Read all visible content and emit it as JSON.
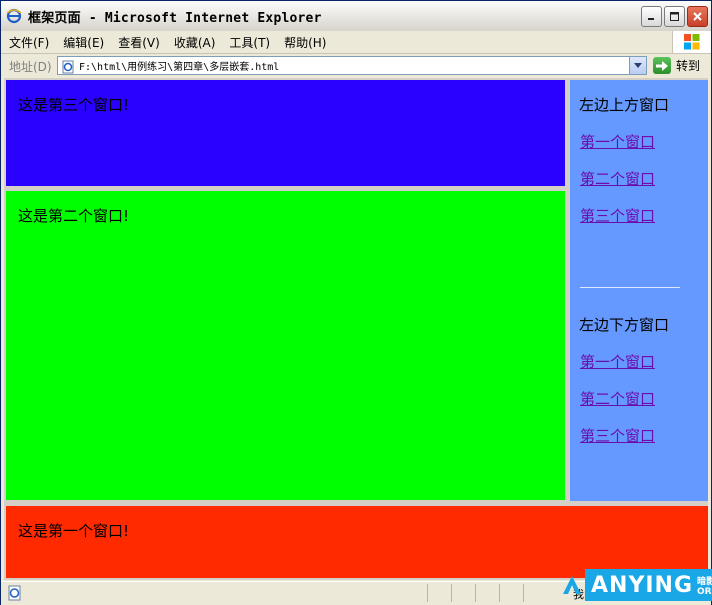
{
  "window": {
    "title": "框架页面 - Microsoft Internet Explorer"
  },
  "menu": {
    "items": [
      {
        "label": "文件(F)"
      },
      {
        "label": "编辑(E)"
      },
      {
        "label": "查看(V)"
      },
      {
        "label": "收藏(A)"
      },
      {
        "label": "工具(T)"
      },
      {
        "label": "帮助(H)"
      }
    ]
  },
  "address_bar": {
    "label": "地址(D)",
    "value": "F:\\html\\用例练习\\第四章\\多层嵌套.html",
    "go_label": "转到"
  },
  "frames": {
    "third": {
      "text": "这是第三个窗口!",
      "color": "#2a00ff"
    },
    "second": {
      "text": "这是第二个窗口!",
      "color": "#00ff00"
    },
    "first": {
      "text": "这是第一个窗口!",
      "color": "#ff2a00"
    },
    "nav": {
      "color": "#6699ff",
      "upper_heading": "左边上方窗口",
      "upper_links": [
        "第一个窗口",
        "第二个窗口",
        "第三个窗口"
      ],
      "lower_heading": "左边下方窗口",
      "lower_links": [
        "第一个窗口",
        "第二个窗口",
        "第三个窗口"
      ]
    }
  },
  "status_bar": {
    "zone_text": "我的电脑"
  },
  "watermark": {
    "brand": "ANYING",
    "cn": "暗影",
    "org": "ORG"
  },
  "icons": [
    "ie-icon",
    "minimize-icon",
    "maximize-icon",
    "close-icon",
    "windows-logo-icon",
    "page-icon",
    "dropdown-arrow-icon",
    "go-arrow-icon"
  ]
}
